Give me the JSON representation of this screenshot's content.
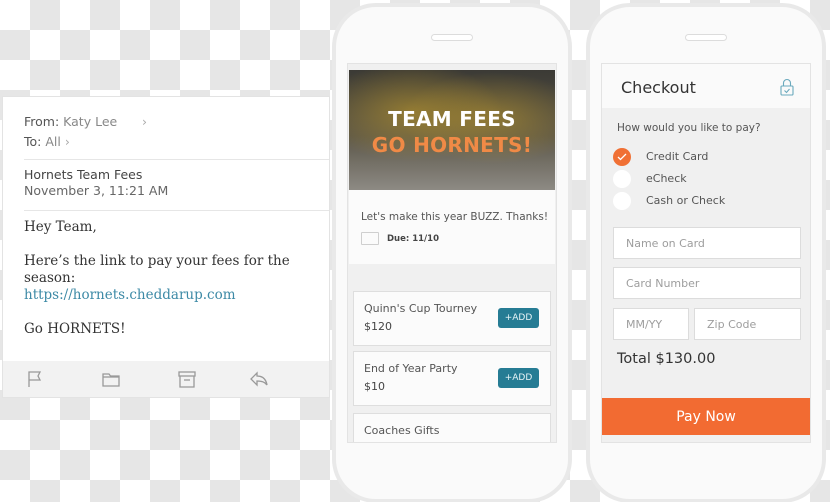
{
  "email": {
    "from_label": "From:",
    "from_name": "Katy Lee",
    "to_label": "To:",
    "to_name": "All",
    "chevron": "›",
    "subject": "Hornets Team Fees",
    "date": "November 3, 11:21 AM",
    "body": {
      "greeting": "Hey Team,",
      "line": "Here’s the link to pay your fees for the season:",
      "link": "https://hornets.cheddarup.com",
      "closing": "Go HORNETS!"
    },
    "toolbar": [
      "flag-icon",
      "folder-icon",
      "archive-icon",
      "reply-icon"
    ]
  },
  "collection": {
    "banner_title": "TEAM FEES",
    "banner_subtitle": "GO HORNETS!",
    "message": "Let's make this year BUZZ. Thanks!",
    "due": "Due: 11/10",
    "items": [
      {
        "name": "Quinn's Cup Tourney",
        "price": "$120",
        "button": "+ADD"
      },
      {
        "name": "End of Year Party",
        "price": "$10",
        "button": "+ADD"
      },
      {
        "name": "Coaches Gifts",
        "price": "",
        "button": ""
      }
    ]
  },
  "checkout": {
    "title": "Checkout",
    "question": "How would you like to pay?",
    "options": [
      {
        "label": "Credit Card",
        "selected": true
      },
      {
        "label": "eCheck",
        "selected": false
      },
      {
        "label": "Cash or Check",
        "selected": false
      }
    ],
    "fields": {
      "name_placeholder": "Name on Card",
      "number_placeholder": "Card Number",
      "expiry_placeholder": "MM/YY",
      "zip_placeholder": "Zip Code"
    },
    "total": "Total $130.00",
    "pay_button": "Pay Now"
  },
  "colors": {
    "accent_orange": "#f26b32",
    "button_teal": "#267c94",
    "link_blue": "#3d8aa6"
  }
}
